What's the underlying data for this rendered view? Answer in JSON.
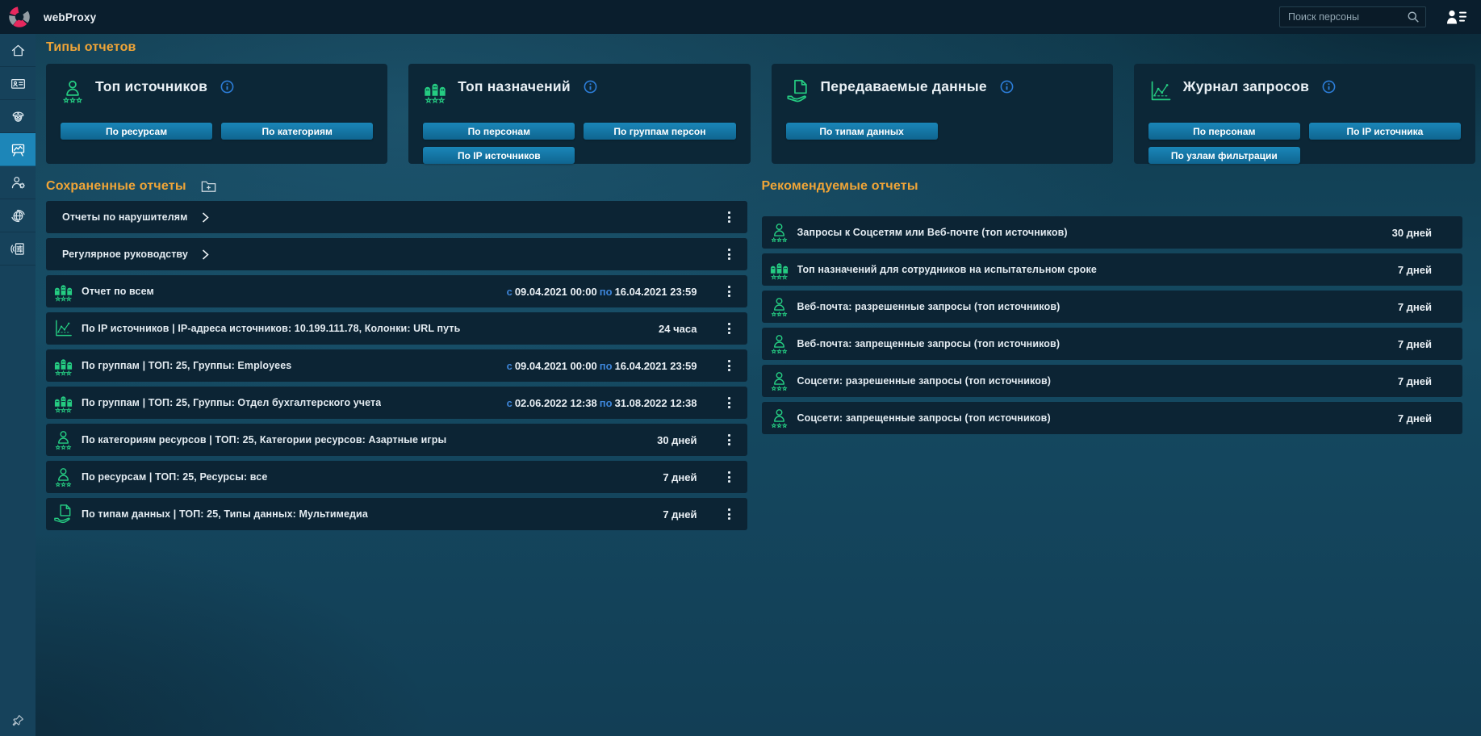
{
  "colors": {
    "accent_title": "#f0a537",
    "button_blue_top": "#1a86b8",
    "button_blue_bottom": "#0f6590",
    "icon_green": "#25cc82",
    "info_blue": "#2c7dd8",
    "date_link_blue": "#3d85d9",
    "sidebar_selected": "#1d86b8",
    "logo_pink": "#e8285e",
    "logo_gray": "#939ca3"
  },
  "topbar": {
    "app_title": "webProxy",
    "search_placeholder": "Поиск персоны"
  },
  "sidebar": {
    "selected_index": 3,
    "items": [
      {
        "name": "home",
        "icon": "home"
      },
      {
        "name": "id-card",
        "icon": "id-card"
      },
      {
        "name": "officer",
        "icon": "officer"
      },
      {
        "name": "reports-board",
        "icon": "board-chart"
      },
      {
        "name": "user-settings",
        "icon": "user-gear"
      },
      {
        "name": "network",
        "icon": "globe"
      },
      {
        "name": "filter-journal",
        "icon": "doc-sliders"
      }
    ]
  },
  "report_types": {
    "section_title": "Типы отчетов",
    "cards": [
      {
        "title": "Топ источников",
        "icon": "person-stars",
        "buttons": [
          "По ресурсам",
          "По категориям"
        ]
      },
      {
        "title": "Топ назначений",
        "icon": "group-stars",
        "buttons": [
          "По персонам",
          "По группам персон",
          "По IP источников"
        ]
      },
      {
        "title": "Передаваемые данные",
        "icon": "doc-hand",
        "buttons": [
          "По типам данных"
        ]
      },
      {
        "title": "Журнал запросов",
        "icon": "chart",
        "buttons": [
          "По персонам",
          "По IP источника",
          "По узлам фильтрации"
        ]
      }
    ]
  },
  "saved_reports": {
    "section_title": "Сохраненные отчеты",
    "rows": [
      {
        "type": "folder",
        "title": "Отчеты по нарушителям"
      },
      {
        "type": "folder",
        "title": "Регулярное руководству"
      },
      {
        "type": "report",
        "icon": "group-stars",
        "title": "Отчет по всем",
        "period": {
          "from_label": "с",
          "from": "09.04.2021 00:00",
          "to_label": "по",
          "to": "16.04.2021 23:59"
        }
      },
      {
        "type": "report",
        "icon": "chart",
        "title": "По IP источников | IP-адреса источников: 10.199.111.78, Колонки: URL путь",
        "duration": "24 часа"
      },
      {
        "type": "report",
        "icon": "group-stars",
        "title": "По группам | ТОП: 25, Группы: Employees",
        "period": {
          "from_label": "с",
          "from": "09.04.2021 00:00",
          "to_label": "по",
          "to": "16.04.2021 23:59"
        }
      },
      {
        "type": "report",
        "icon": "group-stars",
        "title": "По группам | ТОП: 25, Группы: Отдел бухгалтерского учета",
        "period": {
          "from_label": "с",
          "from": "02.06.2022 12:38",
          "to_label": "по",
          "to": "31.08.2022 12:38"
        }
      },
      {
        "type": "report",
        "icon": "person-stars",
        "title": "По категориям ресурсов | ТОП: 25, Категории ресурсов: Азартные игры",
        "duration": "30 дней"
      },
      {
        "type": "report",
        "icon": "person-stars",
        "title": "По ресурсам | ТОП: 25, Ресурсы: все",
        "duration": "7 дней"
      },
      {
        "type": "report",
        "icon": "doc-hand",
        "title": "По типам данных | ТОП: 25, Типы данных: Мультимедиа",
        "duration": "7 дней"
      }
    ]
  },
  "recommended_reports": {
    "section_title": "Рекомендуемые отчеты",
    "rows": [
      {
        "icon": "person-stars",
        "title": "Запросы к Соцсетям или Веб-почте (топ источников)",
        "duration": "30 дней"
      },
      {
        "icon": "group-stars",
        "title": "Топ назначений для сотрудников на испытательном сроке",
        "duration": "7 дней"
      },
      {
        "icon": "person-stars",
        "title": "Веб-почта: разрешенные запросы (топ источников)",
        "duration": "7 дней"
      },
      {
        "icon": "person-stars",
        "title": "Веб-почта: запрещенные запросы (топ источников)",
        "duration": "7 дней"
      },
      {
        "icon": "person-stars",
        "title": "Соцсети: разрешенные запросы (топ источников)",
        "duration": "7 дней"
      },
      {
        "icon": "person-stars",
        "title": "Соцсети: запрещенные запросы (топ источников)",
        "duration": "7 дней"
      }
    ]
  }
}
